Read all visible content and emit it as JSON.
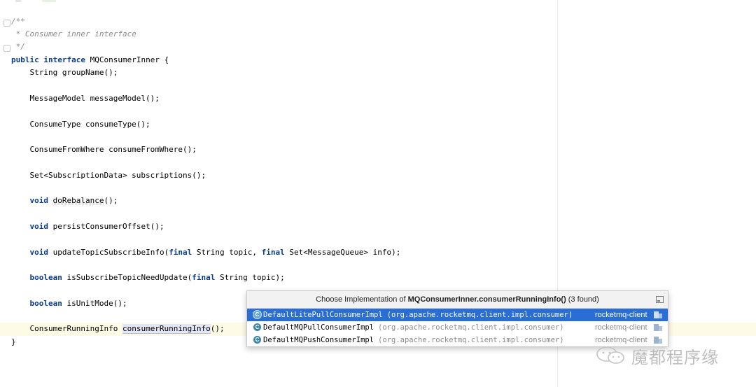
{
  "code": {
    "comment_open": "/**",
    "comment_body": " * Consumer inner interface",
    "comment_close": " */",
    "decl_kw1": "public",
    "decl_kw2": "interface",
    "decl_rest": " MQConsumerInner {",
    "m1": "    String groupName();",
    "m2": "    MessageModel messageModel();",
    "m3": "    ConsumeType consumeType();",
    "m4": "    ConsumeFromWhere consumeFromWhere();",
    "m5": "    Set<SubscriptionData> subscriptions();",
    "m6_kw": "void",
    "m6_name": "doRebalance",
    "m6_rest": "();",
    "m7_kw": "void",
    "m7_rest": " persistConsumerOffset();",
    "m8_kw": "void",
    "m8_a": " updateTopicSubscribeInfo(",
    "m8_kw2": "final",
    "m8_b": " String topic, ",
    "m8_kw3": "final",
    "m8_c": " Set<MessageQueue> info);",
    "m9_kw": "boolean",
    "m9_a": " isSubscribeTopicNeedUpdate(",
    "m9_kw2": "final",
    "m9_b": " String topic);",
    "m10_kw": "boolean",
    "m10_rest": " isUnitMode();",
    "m11_type": "    ConsumerRunningInfo ",
    "m11_name": "consumerRunningInfo",
    "m11_rest": "();",
    "close_brace": "}"
  },
  "popup": {
    "title_prefix": "Choose Implementation of ",
    "title_target": "MQConsumerInner.consumerRunningInfo()",
    "title_suffix": " (3 found)",
    "items": [
      {
        "class_name": "DefaultLitePullConsumerImpl",
        "package": "(org.apache.rocketmq.client.impl.consumer)",
        "module": "rocketmq-client",
        "selected": true,
        "icon": "class-icon"
      },
      {
        "class_name": "DefaultMQPullConsumerImpl",
        "package": "(org.apache.rocketmq.client.impl.consumer)",
        "module": "rocketmq-client",
        "selected": false,
        "icon": "class-icon"
      },
      {
        "class_name": "DefaultMQPushConsumerImpl",
        "package": "(org.apache.rocketmq.client.impl.consumer)",
        "module": "rocketmq-client",
        "selected": false,
        "icon": "class-icon"
      }
    ],
    "class_icon_letter": "C"
  },
  "watermark": {
    "text": "魔都程序缘",
    "icon": "wechat-logo-icon"
  },
  "colors": {
    "keyword": "#0a3d8a",
    "comment": "#8c8c8c",
    "selection": "#2a6dd4",
    "current_line": "#fdfbe6"
  }
}
